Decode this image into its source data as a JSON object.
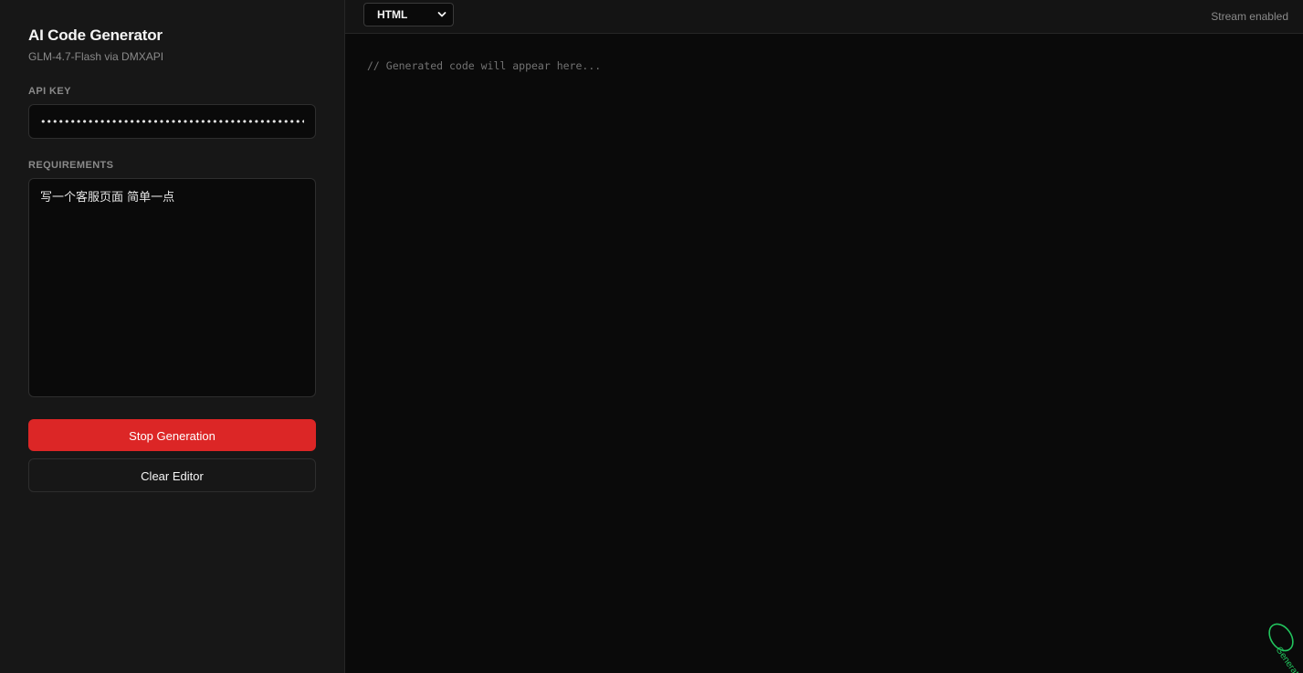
{
  "sidebar": {
    "title": "AI Code Generator",
    "subtitle": "GLM-4.7-Flash via DMXAPI",
    "api_key": {
      "label": "API KEY",
      "value": "••••••••••••••••••••••••••••••••••••••••••••••••••••••••••"
    },
    "requirements": {
      "label": "REQUIREMENTS",
      "value": "写一个客服页面 简单一点"
    },
    "buttons": {
      "stop_label": "Stop Generation",
      "clear_label": "Clear Editor"
    }
  },
  "toolbar": {
    "language": {
      "selected": "HTML"
    },
    "stream_status": "Stream enabled"
  },
  "editor": {
    "placeholder": "// Generated code will appear here..."
  },
  "status_badge": {
    "text": "Generating",
    "color": "#22c55e",
    "icon": "spinner-icon"
  },
  "colors": {
    "danger": "#dc2626",
    "sidebar_bg": "#171717",
    "editor_bg": "#0a0a0a",
    "accent_green": "#22c55e"
  }
}
